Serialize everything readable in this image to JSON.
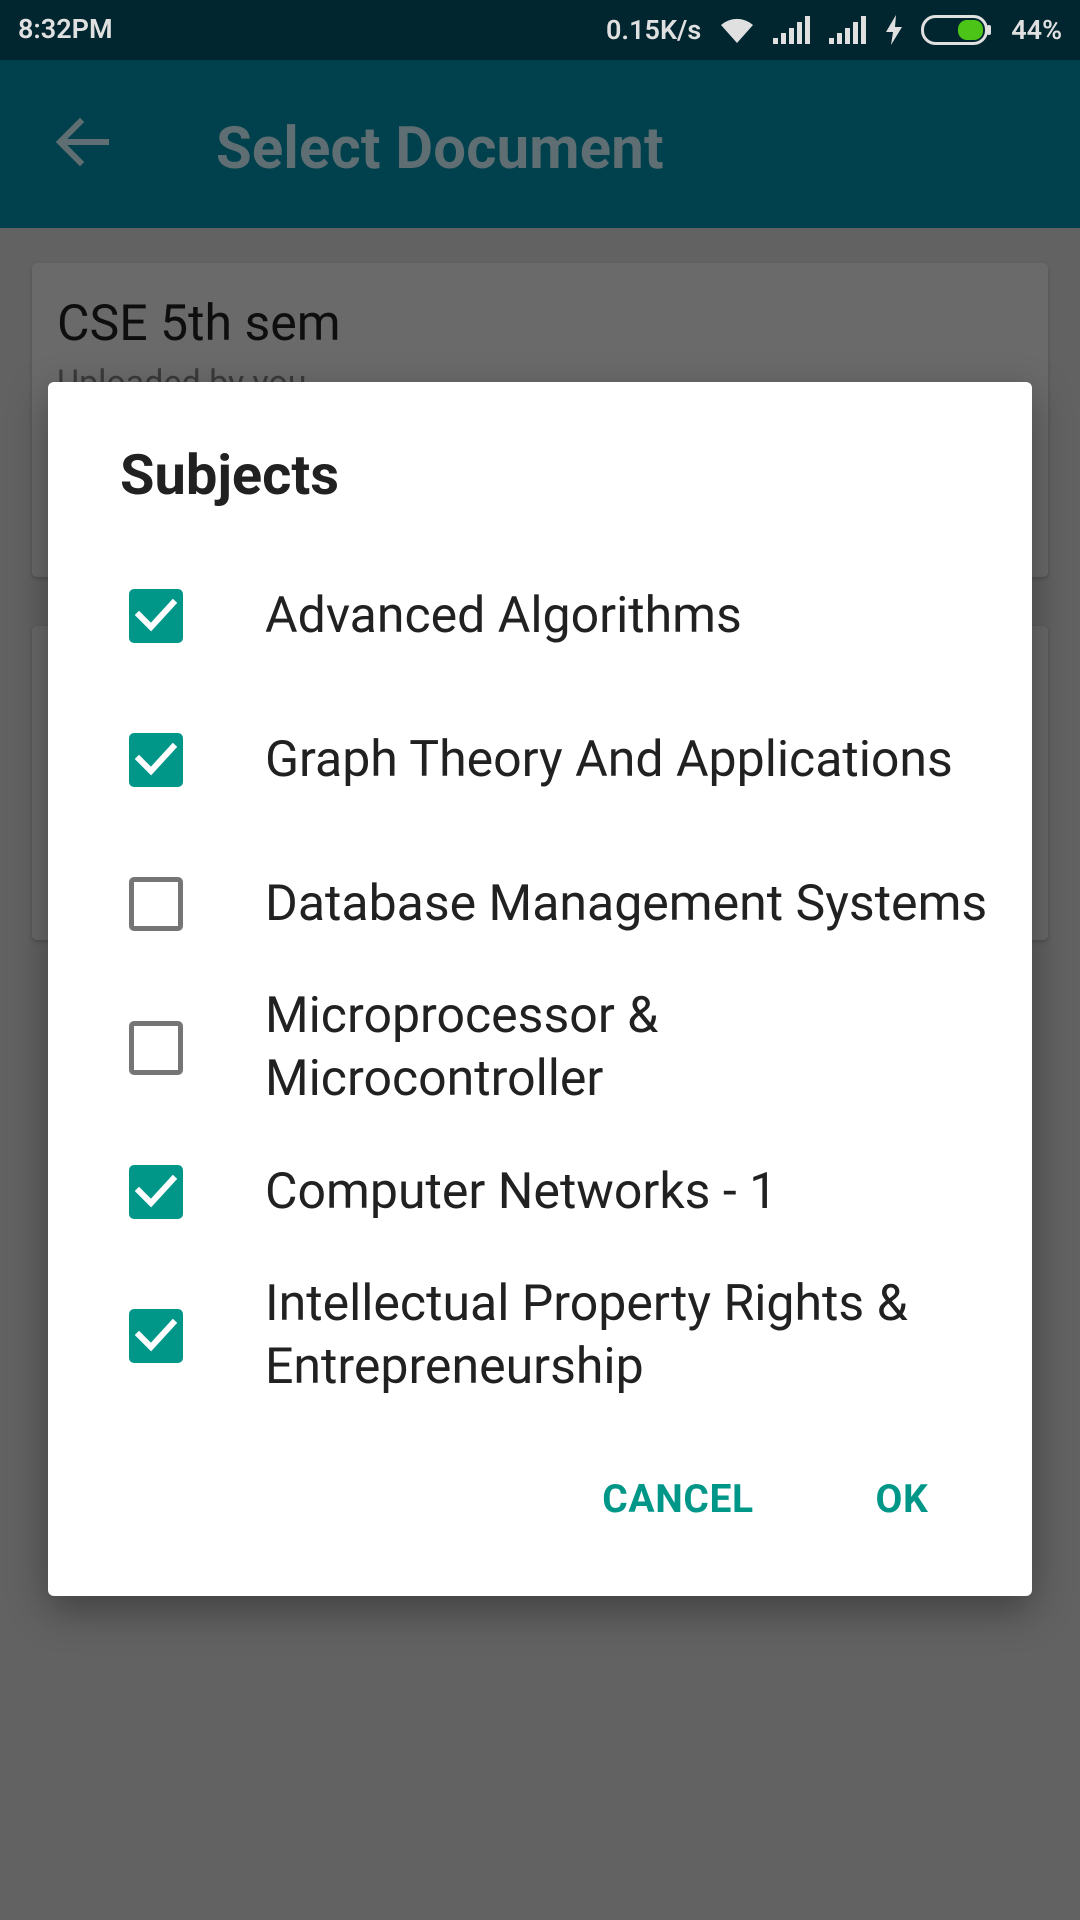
{
  "status_bar": {
    "time": "8:32PM",
    "network_speed": "0.15K/s",
    "battery": "44%",
    "battery_level": 0.44,
    "icons": [
      "wifi-icon",
      "signal-icon",
      "signal-icon",
      "charging-icon",
      "battery-icon"
    ]
  },
  "app_bar": {
    "title": "Select Document",
    "back_icon": "arrow-left-icon"
  },
  "background_cards": [
    {
      "title": "CSE 5th sem",
      "subtitle": "Uploaded by you"
    },
    {
      "title": "",
      "subtitle": ""
    }
  ],
  "dialog": {
    "title": "Subjects",
    "options": [
      {
        "label": "Advanced Algorithms",
        "checked": true
      },
      {
        "label": "Graph Theory And Applications",
        "checked": true
      },
      {
        "label": "Database Management Systems",
        "checked": false
      },
      {
        "label": "Microprocessor & Microcontroller",
        "checked": false
      },
      {
        "label": "Computer Networks - 1",
        "checked": true
      },
      {
        "label": "Intellectual Property Rights & Entrepreneurship",
        "checked": true
      }
    ],
    "cancel_label": "CANCEL",
    "ok_label": "OK"
  },
  "colors": {
    "status_bar": "#01262F",
    "app_bar": "#00414D",
    "accent": "#009688",
    "scrim_background": "#626262",
    "dialog": "#FFFFFF"
  }
}
